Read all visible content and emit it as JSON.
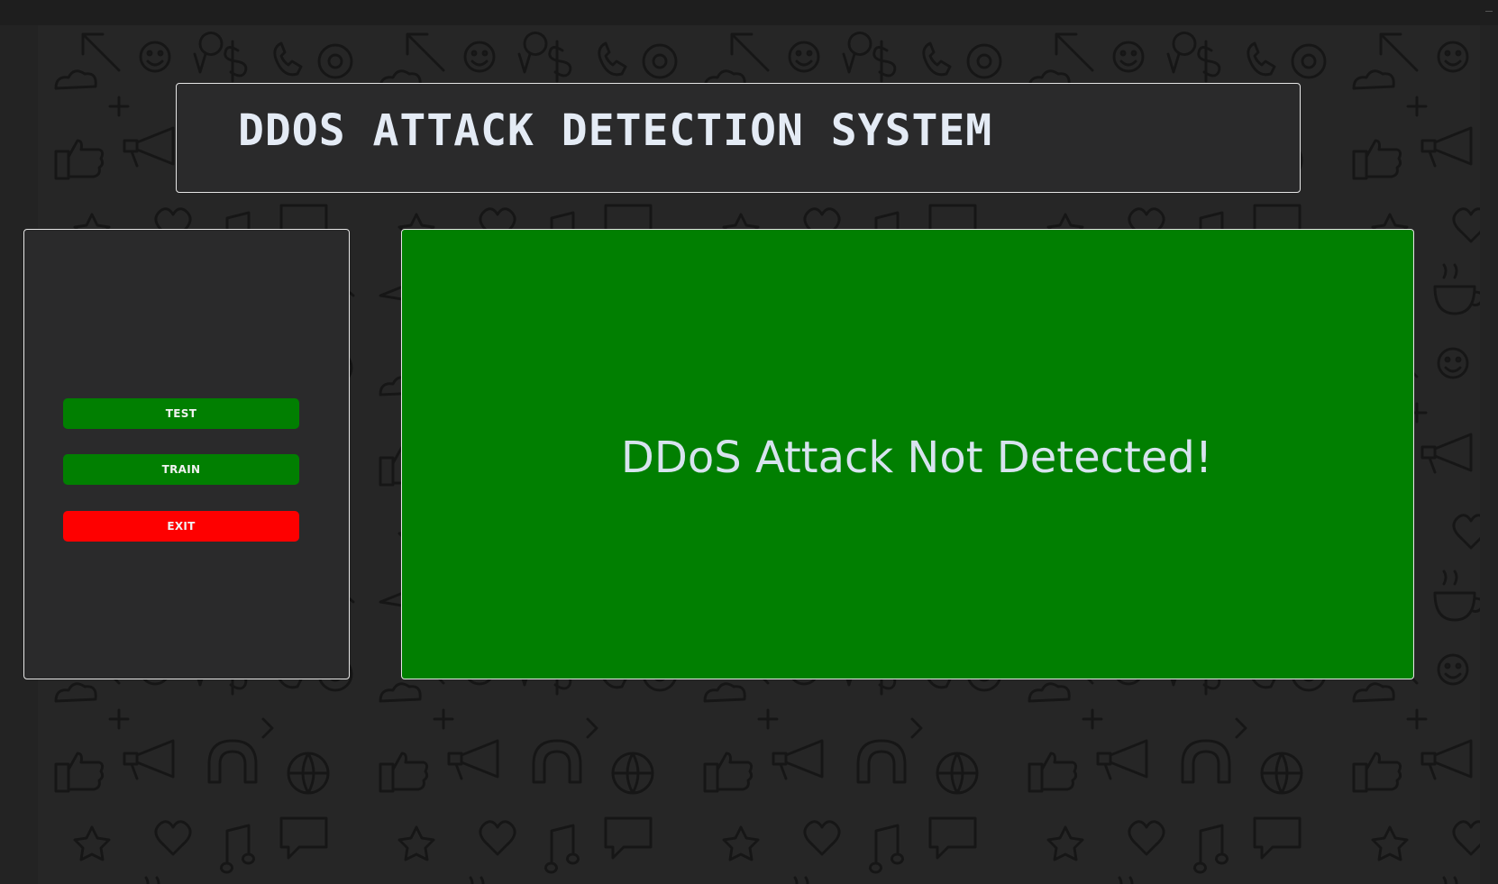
{
  "app": {
    "title": "DDOS ATTACK DETECTION SYSTEM"
  },
  "controls": {
    "test_label": "TEST",
    "train_label": "TRAIN",
    "exit_label": "EXIT"
  },
  "result": {
    "message": "DDoS Attack Not Detected!"
  },
  "colors": {
    "background": "#232323",
    "panel": "#2a2a2b",
    "panel_border": "#e6e6e6",
    "title_text": "#e4ebf5",
    "button_green": "#017f01",
    "button_red": "#fe0000",
    "result_background": "#017f01",
    "result_text": "#d7e3ee"
  },
  "wallpaper": {
    "pattern": "doodle-icons",
    "icons": [
      "arrow-icon",
      "smiley-icon",
      "location-pin-icon",
      "dollar-icon",
      "phone-icon",
      "thumbs-up-icon",
      "at-sign-icon",
      "megaphone-icon",
      "magnet-icon",
      "cloud-icon",
      "globe-icon",
      "star-icon",
      "heart-icon",
      "music-note-icon",
      "speech-bubble-icon",
      "paper-plane-icon",
      "coffee-cup-icon",
      "network-icon"
    ]
  }
}
